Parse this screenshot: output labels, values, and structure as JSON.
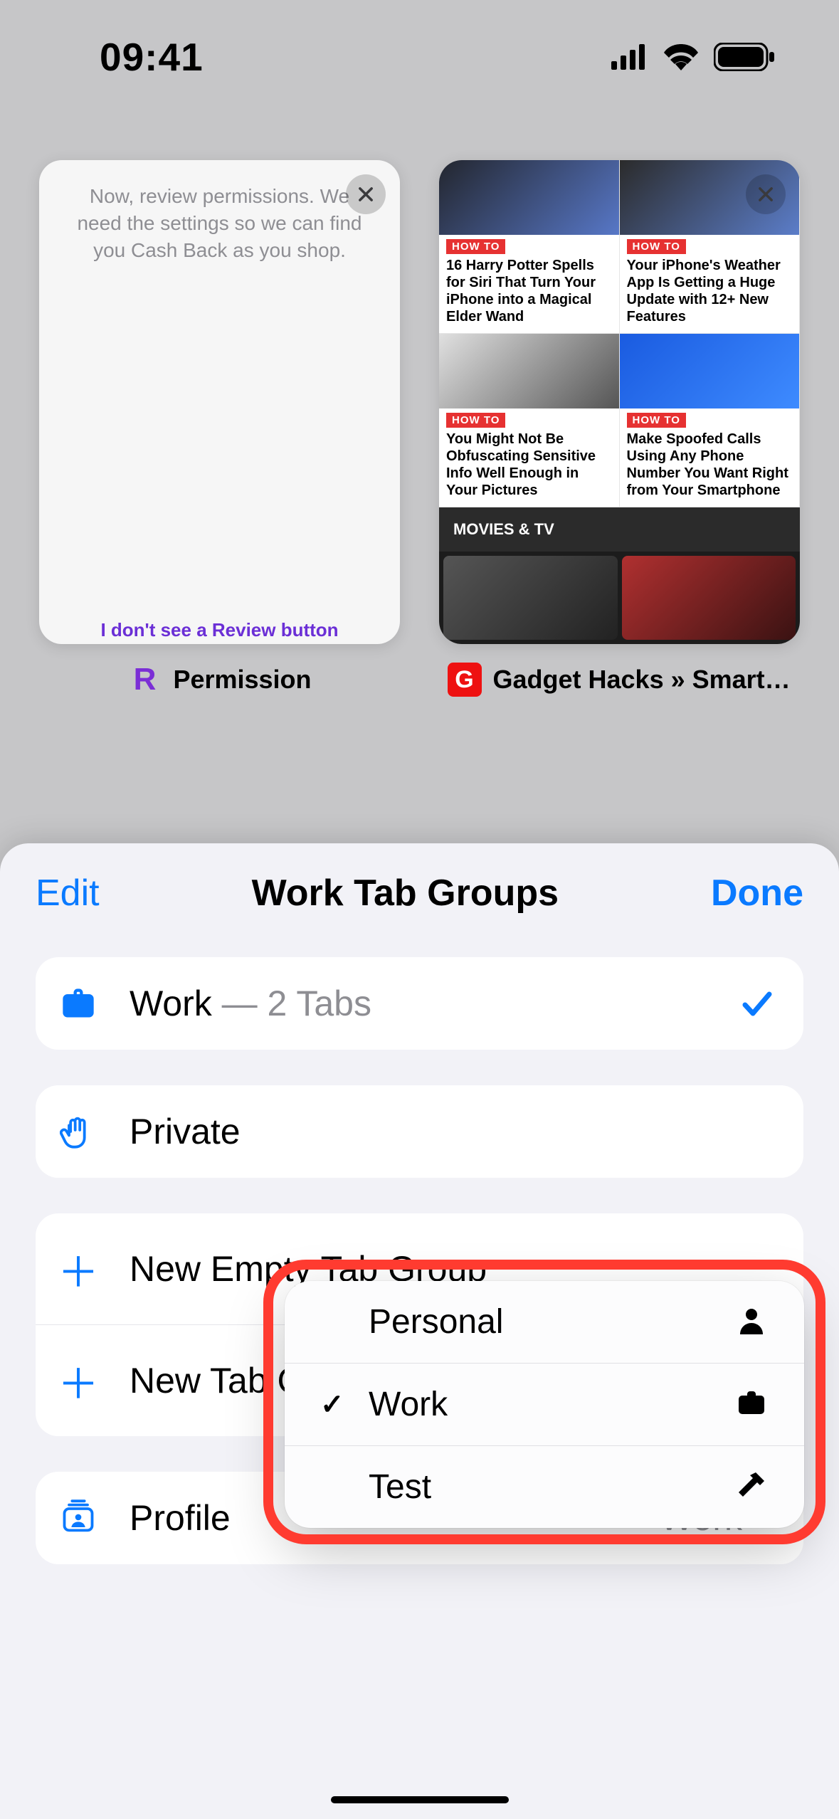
{
  "status": {
    "time": "09:41"
  },
  "tabs": [
    {
      "favicon_letter": "R",
      "title": "Permission",
      "body_text": "Now, review permissions. We need the settings so we can find you Cash Back as you shop.",
      "bottom_link": "I don't see a Review button"
    },
    {
      "favicon_letter": "G",
      "title": "Gadget Hacks » Smartph…",
      "howto_tag": "HOW TO",
      "articles": [
        "16 Harry Potter Spells for Siri That Turn Your iPhone into a Magical Elder Wand",
        "Your iPhone's Weather App Is Getting a Huge Update with 12+ New Features",
        "You Might Not Be Obfuscating Sensitive Info Well Enough in Your Pictures",
        "Make Spoofed Calls Using Any Phone Number You Want Right from Your Smartphone"
      ],
      "section": "MOVIES & TV"
    }
  ],
  "sheet": {
    "edit": "Edit",
    "title": "Work Tab Groups",
    "done": "Done",
    "work": {
      "name": "Work",
      "tabs_suffix": " — 2 Tabs"
    },
    "private": "Private",
    "new_empty": "New Empty Tab Group",
    "new_tab_group": "New Tab Group",
    "profile_label": "Profile",
    "profile_value": "Work"
  },
  "popover": {
    "items": [
      {
        "label": "Personal",
        "selected": false,
        "icon": "person"
      },
      {
        "label": "Work",
        "selected": true,
        "icon": "briefcase"
      },
      {
        "label": "Test",
        "selected": false,
        "icon": "hammer"
      }
    ]
  }
}
